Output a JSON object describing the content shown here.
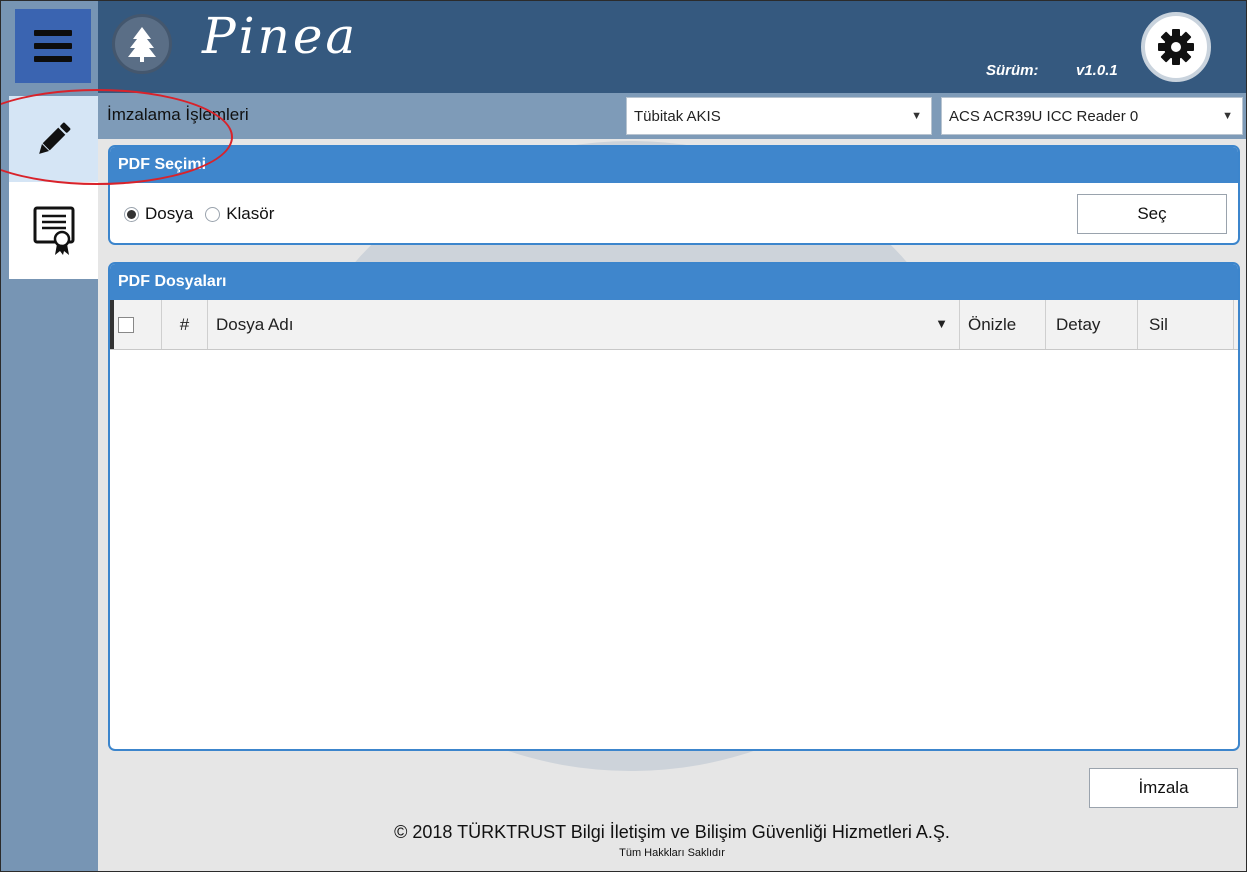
{
  "header": {
    "app_name": "Pinea",
    "version_label": "Sürüm:",
    "version_value": "v1.0.1"
  },
  "strip": {
    "title": "İmzalama İşlemleri",
    "card_select": {
      "value": "Tübitak AKIS"
    },
    "reader_select": {
      "value": "ACS ACR39U ICC Reader 0"
    }
  },
  "pdf_select": {
    "title": "PDF Seçimi",
    "options": [
      "Dosya",
      "Klasör"
    ],
    "selected": "Dosya",
    "button_label": "Seç"
  },
  "pdf_files": {
    "title": "PDF Dosyaları",
    "columns": [
      "#",
      "Dosya Adı",
      "Önizle",
      "Detay",
      "Sil"
    ],
    "rows": []
  },
  "actions": {
    "sign_label": "İmzala"
  },
  "footer": {
    "copyright": "© 2018 TÜRKTRUST Bilgi İletişim ve Bilişim Güvenliği Hizmetleri A.Ş.",
    "rights": "Tüm Hakkları Saklıdır"
  },
  "icons": {
    "menu": "hamburger-menu-icon",
    "sign": "pencil-icon",
    "certificate": "certificate-icon",
    "logo": "pine-tree-icon",
    "settings": "gear-icon",
    "filter": "filter-icon"
  },
  "colors": {
    "header": "#35597f",
    "sidebar": "#7795b4",
    "panel_accent": "#3f86cc",
    "menu_button": "#3a64b1",
    "annotation": "#d9222a"
  }
}
